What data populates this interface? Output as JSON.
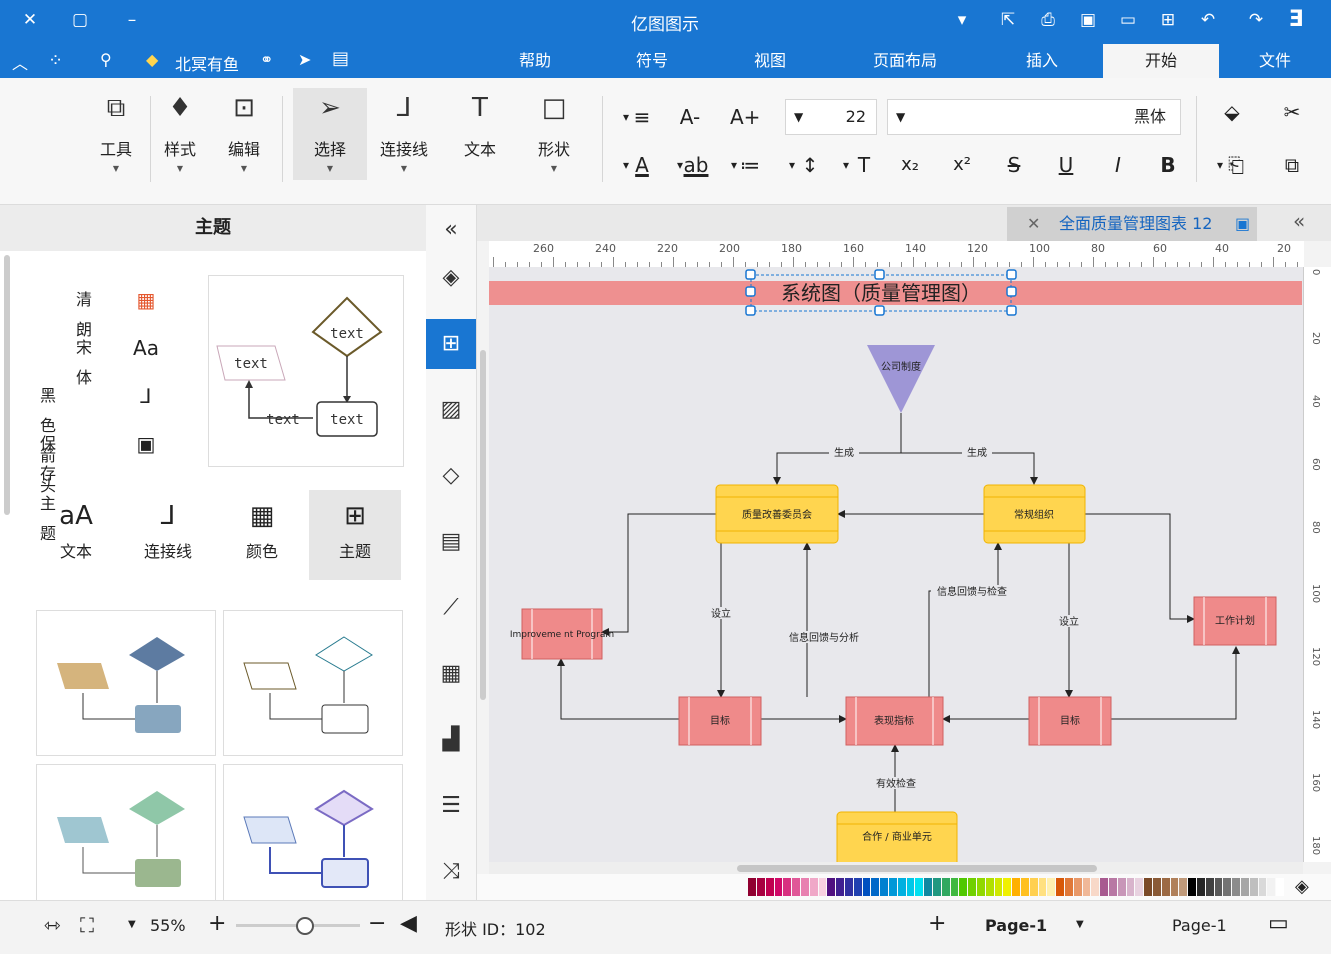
{
  "app": {
    "title": "亿图图示"
  },
  "titlebar": {
    "right_icons": [
      "e-logo-icon",
      "redo-icon",
      "chevron-down-icon",
      "undo-icon",
      "new-icon",
      "open-icon",
      "save-icon",
      "print-icon",
      "export-icon",
      "chevron-down-icon"
    ],
    "window_controls": [
      "minimize-icon",
      "maximize-icon",
      "close-icon"
    ]
  },
  "menubar": {
    "tabs": [
      {
        "label": "文件"
      },
      {
        "label": "开始"
      },
      {
        "label": "插入"
      },
      {
        "label": "页面布局"
      },
      {
        "label": "视图"
      },
      {
        "label": "符号"
      },
      {
        "label": "帮助"
      }
    ],
    "active_tab": "开始",
    "quick": {
      "member_label": "北冥有鱼"
    }
  },
  "ribbon": {
    "font_family": "黑体",
    "font_size": "22",
    "buttons": [
      {
        "label": "形状"
      },
      {
        "label": "文本"
      },
      {
        "label": "连接线"
      },
      {
        "label": "选择"
      },
      {
        "label": "编辑"
      },
      {
        "label": "样式"
      },
      {
        "label": "工具"
      }
    ],
    "format_row1": [
      "A+",
      "A-",
      "≡"
    ],
    "format_row2": [
      "B",
      "I",
      "U",
      "S",
      "x²",
      "x₂",
      "T",
      "↕",
      "≔",
      "ab",
      "A"
    ]
  },
  "left_panel": {
    "header": "主题",
    "theme_options": [
      {
        "label": "清朗",
        "icon": "palette-icon"
      },
      {
        "label": "宋体",
        "icon": "font-icon"
      },
      {
        "label": "黑色箭头",
        "icon": "connector-icon"
      },
      {
        "label": "保存主题",
        "icon": "save-theme-icon"
      }
    ],
    "preview_texts": [
      "text",
      "text",
      "text",
      "text"
    ],
    "grid_buttons": [
      {
        "label": "主题",
        "icon": "theme-icon"
      },
      {
        "label": "颜色",
        "icon": "color-icon"
      },
      {
        "label": "连接线",
        "icon": "connector-icon"
      },
      {
        "label": "文本",
        "icon": "text-icon"
      }
    ]
  },
  "vtoolbar": {
    "icons": [
      "collapse-icon",
      "fill-icon",
      "theme-icon",
      "image-icon",
      "layers-icon",
      "notes-icon",
      "chart-icon",
      "table-icon",
      "puzzle-icon",
      "gantt-icon",
      "shuffle-icon"
    ]
  },
  "doc_tab": {
    "title": "全面质量管理图表 12"
  },
  "ruler": {
    "h_ticks": [
      "20",
      "40",
      "60",
      "80",
      "100",
      "120",
      "140",
      "160",
      "180",
      "200",
      "220",
      "240",
      "260"
    ],
    "v_ticks": [
      "0",
      "20",
      "40",
      "60",
      "80",
      "100",
      "120",
      "140",
      "160",
      "180"
    ]
  },
  "diagram": {
    "title": "系统图（质量管理图）",
    "nodes": {
      "company": "公司制度",
      "committee": "质量改善委员会",
      "regular": "常规组织",
      "improvement": "Improveme nt Program",
      "workplan": "工作计划",
      "target_left": "目标",
      "target_right": "目标",
      "indicator": "表现指标",
      "unit": "合作 / 商业单元"
    },
    "edges": {
      "gen_left": "生成",
      "gen_right": "生成",
      "set_left": "设立",
      "set_right": "设立",
      "feedback_left": "信息回馈与分析",
      "feedback_right": "信息回馈与检查",
      "check": "有效检查"
    }
  },
  "status": {
    "page_left": "Page-1",
    "page_right": "Page-1",
    "shape_id": "形状 ID：102",
    "zoom": "55%",
    "zoom_fraction": 0.55
  },
  "colors": {
    "primary": "#1976d2",
    "node_yellow": "#ffd54f",
    "node_red": "#ef8a8a",
    "title_band": "#ee9090",
    "triangle": "#9e96d6"
  }
}
